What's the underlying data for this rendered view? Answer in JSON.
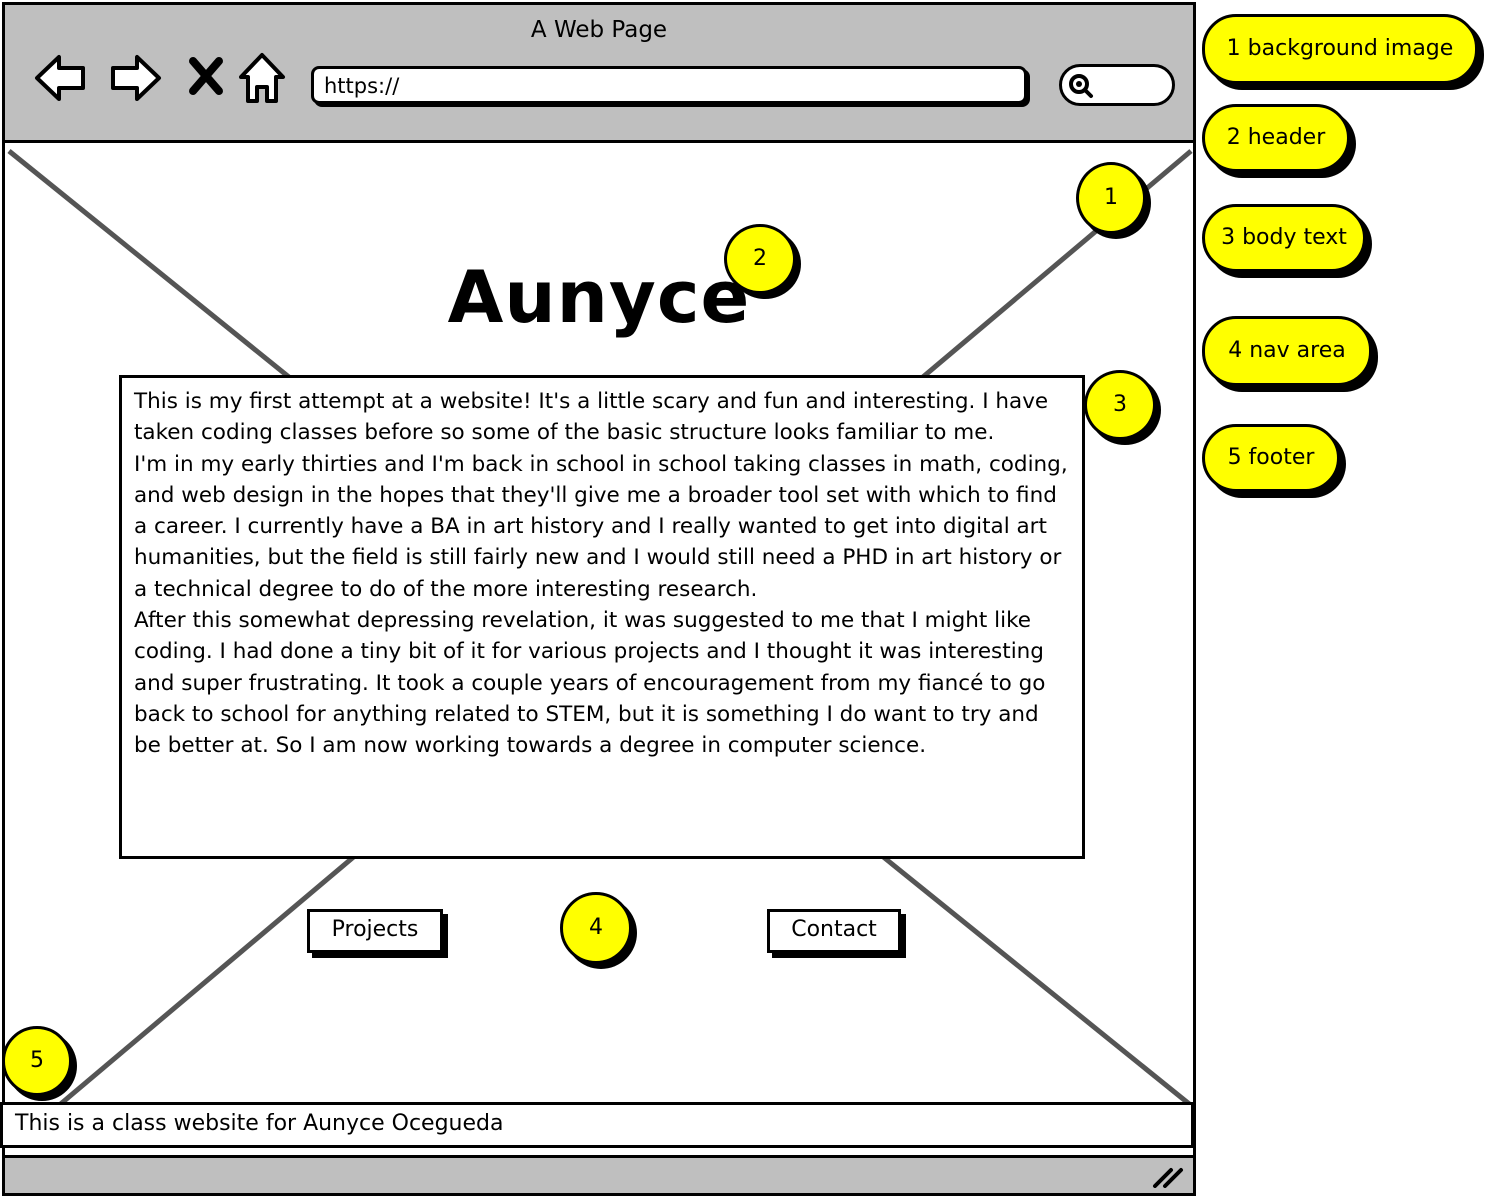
{
  "window": {
    "title": "A Web Page",
    "url": "https://"
  },
  "page": {
    "heading": "Aunyce",
    "body_paragraphs": [
      "This is my first attempt at a website! It's a little scary and fun and interesting. I have taken coding classes before so some of the basic structure looks familiar to me.",
      "I'm in my early thirties and I'm back in school in school taking classes in math, coding, and web design in the hopes that they'll give me a broader tool set with which to find a career. I currently have a BA in art history and I really wanted to get into digital art humanities, but the field is still fairly new and I would still need a PHD in art history or a technical degree to do of the more interesting research.",
      "After this somewhat depressing revelation, it was suggested to me that I might like coding. I had done a tiny bit of it for various projects and I thought it was interesting and super frustrating. It took a couple years of encouragement from my fiancé to go back to school for anything related to STEM, but it is something I do want to try and be better at. So I am now working towards a degree in computer science."
    ],
    "nav": {
      "projects_label": "Projects",
      "contact_label": "Contact"
    },
    "footer_text": "This is a class website for Aunyce Ocegueda"
  },
  "badges": {
    "b1": "1",
    "b2": "2",
    "b3": "3",
    "b4": "4",
    "b5": "5"
  },
  "legend": [
    "1 background image",
    "2 header",
    "3 body text",
    "4 nav area",
    "5 footer"
  ],
  "icons": [
    "back-arrow-icon",
    "forward-arrow-icon",
    "stop-icon",
    "home-icon",
    "search-icon",
    "resize-grip-icon"
  ],
  "colors": {
    "annotation": "#ffff00",
    "chrome": "#bfbfbf",
    "placeholder_lines": "#555555"
  }
}
